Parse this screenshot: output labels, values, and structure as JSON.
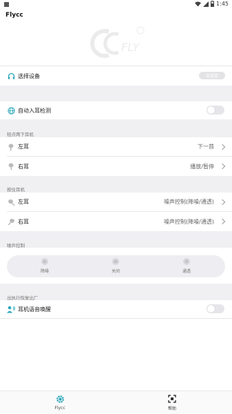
{
  "status": {
    "time": "1:45"
  },
  "app": {
    "title": "Flycc"
  },
  "device": {
    "label": "选择设备",
    "connect_status": "未连接"
  },
  "auto_ear": {
    "label": "自动入耳检测"
  },
  "tap_section": {
    "title": "轻点两下耳机",
    "items": [
      {
        "label": "左耳",
        "value": "下一首"
      },
      {
        "label": "右耳",
        "value": "播放/暂停"
      }
    ]
  },
  "hold_section": {
    "title": "按住耳机",
    "items": [
      {
        "label": "左耳",
        "value": "噪声控制(降噪/通透)"
      },
      {
        "label": "右耳",
        "value": "噪声控制(降噪/通透)"
      }
    ]
  },
  "noise_section": {
    "title": "噪声控制",
    "options": [
      "降噪",
      "关闭",
      "通透"
    ]
  },
  "reset_section": {
    "title": "出执行恢复出厂"
  },
  "voice_wake": {
    "label": "耳机语音唤醒"
  },
  "nav": {
    "items": [
      "Flycc",
      "帮助"
    ]
  },
  "colors": {
    "accent": "#2aa6b8",
    "background_gap": "#f0f0f3"
  }
}
